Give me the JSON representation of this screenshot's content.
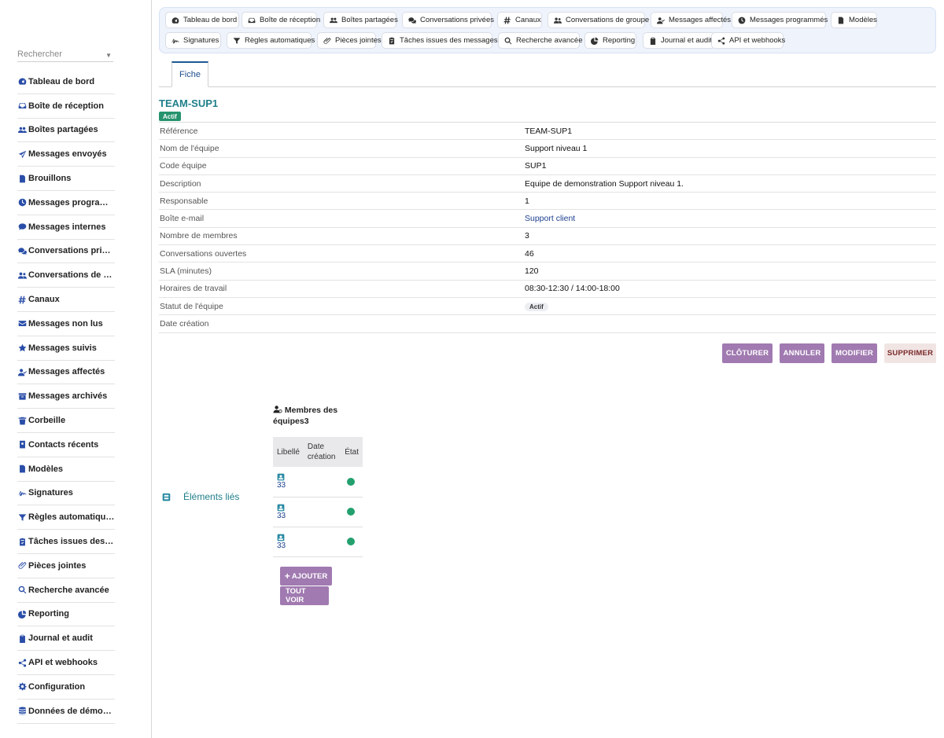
{
  "sidebar": {
    "search_placeholder": "Rechercher",
    "items": [
      {
        "label": "Tableau de bord",
        "icon": "dashboard-icon"
      },
      {
        "label": "Boîte de réception",
        "icon": "inbox-icon"
      },
      {
        "label": "Boîtes partagées",
        "icon": "users-icon"
      },
      {
        "label": "Messages envoyés",
        "icon": "paper-plane-icon"
      },
      {
        "label": "Brouillons",
        "icon": "file-icon"
      },
      {
        "label": "Messages programmés",
        "icon": "clock-icon"
      },
      {
        "label": "Messages internes",
        "icon": "comment-icon"
      },
      {
        "label": "Conversations privées",
        "icon": "comments-icon"
      },
      {
        "label": "Conversations de groupe",
        "icon": "user-group-icon"
      },
      {
        "label": "Canaux",
        "icon": "hashtag-icon"
      },
      {
        "label": "Messages non lus",
        "icon": "envelope-icon"
      },
      {
        "label": "Messages suivis",
        "icon": "star-icon"
      },
      {
        "label": "Messages affectés",
        "icon": "user-check-icon"
      },
      {
        "label": "Messages archivés",
        "icon": "archive-icon"
      },
      {
        "label": "Corbeille",
        "icon": "trash-icon"
      },
      {
        "label": "Contacts récents",
        "icon": "address-book-icon"
      },
      {
        "label": "Modèles",
        "icon": "file-icon"
      },
      {
        "label": "Signatures",
        "icon": "signature-icon"
      },
      {
        "label": "Règles automatiques",
        "icon": "filter-icon"
      },
      {
        "label": "Tâches issues des messages",
        "icon": "task-icon"
      },
      {
        "label": "Pièces jointes",
        "icon": "paperclip-icon"
      },
      {
        "label": "Recherche avancée",
        "icon": "search-icon"
      },
      {
        "label": "Reporting",
        "icon": "chart-pie-icon"
      },
      {
        "label": "Journal et audit",
        "icon": "clipboard-icon"
      },
      {
        "label": "API et webhooks",
        "icon": "share-icon"
      },
      {
        "label": "Configuration",
        "icon": "gear-icon"
      },
      {
        "label": "Données de démonstration",
        "icon": "database-icon"
      }
    ]
  },
  "topbar": {
    "row1": [
      "Tableau de bord",
      "Boîte de réception",
      "Boîtes partagées",
      "Conversations privées",
      "Canaux",
      "Conversations de groupe",
      "Messages affectés",
      "Messages programmés",
      "Modèles"
    ],
    "row2": [
      "Signatures",
      "Règles automatiques",
      "Pièces jointes",
      "Tâches issues des messages",
      "Recherche avancée",
      "Reporting",
      "Journal et audit",
      "API et webhooks"
    ]
  },
  "tab": {
    "label": "Fiche"
  },
  "record": {
    "title": "TEAM-SUP1",
    "status_badge": "Actif",
    "fields": [
      {
        "label": "Référence",
        "value": "TEAM-SUP1"
      },
      {
        "label": "Nom de l'équipe",
        "value": "Support niveau 1"
      },
      {
        "label": "Code équipe",
        "value": "SUP1"
      },
      {
        "label": "Description",
        "value": "Equipe de demonstration Support niveau 1."
      },
      {
        "label": "Responsable",
        "value": "1"
      },
      {
        "label": "Boîte e-mail",
        "value": "Support client"
      },
      {
        "label": "Nombre de membres",
        "value": "3"
      },
      {
        "label": "Conversations ouvertes",
        "value": "46"
      },
      {
        "label": "SLA (minutes)",
        "value": "120"
      },
      {
        "label": "Horaires de travail",
        "value": "08:30-12:30 / 14:00-18:00"
      },
      {
        "label": "Statut de l'équipe",
        "value": "Actif"
      },
      {
        "label": "Date création",
        "value": ""
      }
    ]
  },
  "actions": {
    "close": "CLÔTURER",
    "cancel": "ANNULER",
    "edit": "MODIFIER",
    "delete": "SUPPRIMER"
  },
  "linked": {
    "label": "Éléments liés"
  },
  "members": {
    "title": "Membres des équipes",
    "count": "3",
    "columns": [
      "Libellé",
      "Date création",
      "État"
    ],
    "rows": [
      {
        "id": "33"
      },
      {
        "id": "33"
      },
      {
        "id": "33"
      }
    ],
    "add_label": "AJOUTER",
    "view_all_label": "TOUT VOIR"
  },
  "colors": {
    "accent": "#a07ab0",
    "title": "#1f7f8a",
    "status_green": "#23a06e"
  }
}
